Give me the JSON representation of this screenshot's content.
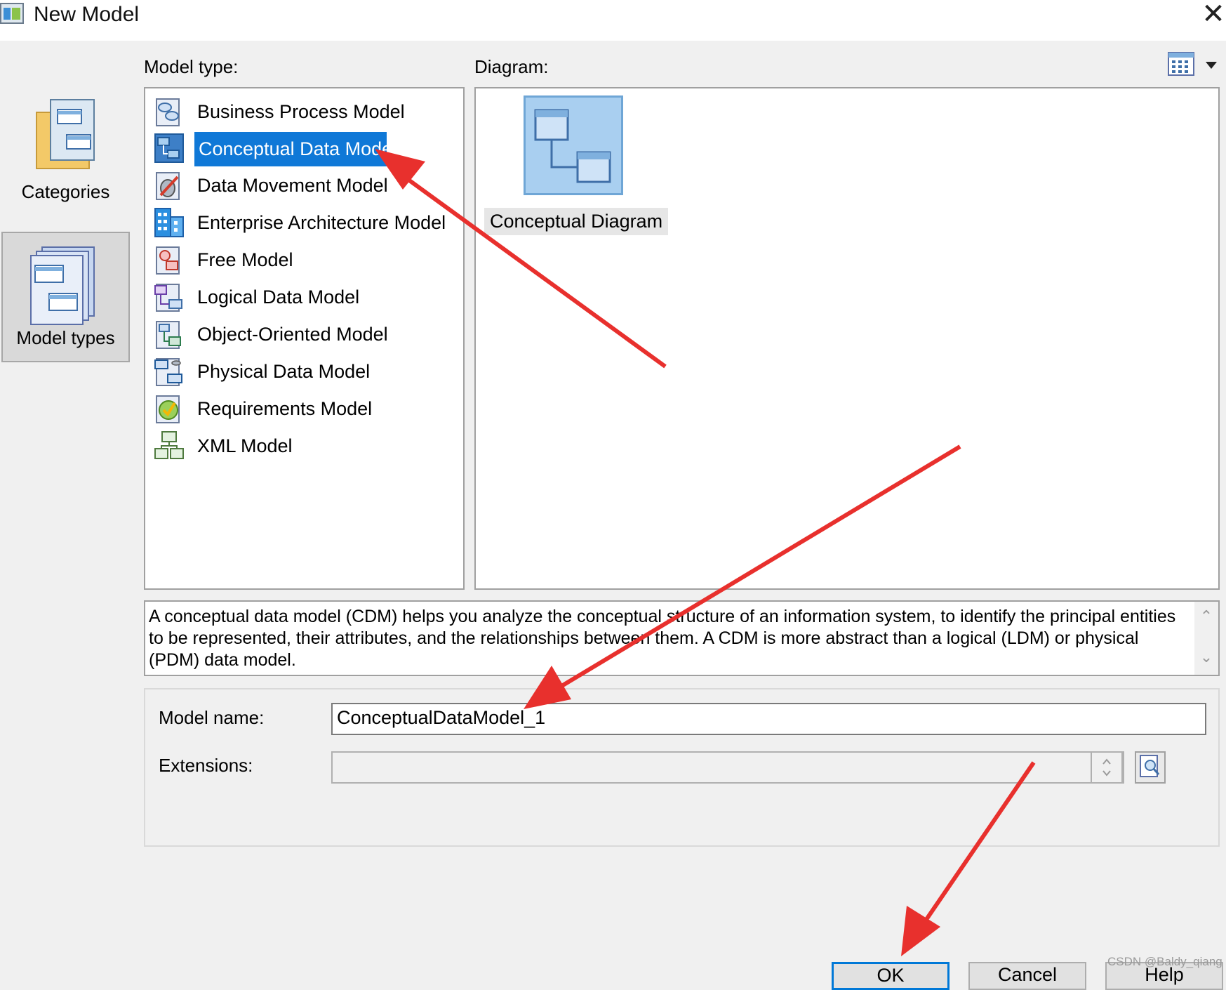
{
  "window": {
    "title": "New Model",
    "close_icon": "close-icon"
  },
  "sidebar": {
    "items": [
      {
        "label": "Categories",
        "icon": "categories-folder-icon",
        "selected": false
      },
      {
        "label": "Model types",
        "icon": "model-types-icon",
        "selected": true
      }
    ]
  },
  "model_type": {
    "label": "Model type:",
    "items": [
      {
        "label": "Business Process Model",
        "icon": "business-process-model-icon"
      },
      {
        "label": "Conceptual Data Model",
        "icon": "conceptual-data-model-icon",
        "selected": true
      },
      {
        "label": "Data Movement Model",
        "icon": "data-movement-model-icon"
      },
      {
        "label": "Enterprise Architecture Model",
        "icon": "enterprise-architecture-model-icon"
      },
      {
        "label": "Free Model",
        "icon": "free-model-icon"
      },
      {
        "label": "Logical Data Model",
        "icon": "logical-data-model-icon"
      },
      {
        "label": "Object-Oriented Model",
        "icon": "object-oriented-model-icon"
      },
      {
        "label": "Physical Data Model",
        "icon": "physical-data-model-icon"
      },
      {
        "label": "Requirements Model",
        "icon": "requirements-model-icon"
      },
      {
        "label": "XML Model",
        "icon": "xml-model-icon"
      }
    ]
  },
  "diagram": {
    "label": "Diagram:",
    "items": [
      {
        "label": "Conceptual Diagram",
        "icon": "conceptual-diagram-icon"
      }
    ],
    "view_toggle_icon": "list-view-icon"
  },
  "description": {
    "text": "A conceptual data model (CDM) helps you analyze the conceptual structure of an information system, to identify the principal entities to be represented, their attributes, and the relationships between them. A CDM is more abstract than a logical (LDM) or physical (PDM) data model."
  },
  "form": {
    "model_name_label": "Model name:",
    "model_name_value": "ConceptualDataModel_1",
    "extensions_label": "Extensions:",
    "extensions_value": ""
  },
  "buttons": {
    "ok": "OK",
    "cancel": "Cancel",
    "help": "Help"
  },
  "watermark": "CSDN @Baldy_qiang",
  "annotation_color": "#e8302d"
}
